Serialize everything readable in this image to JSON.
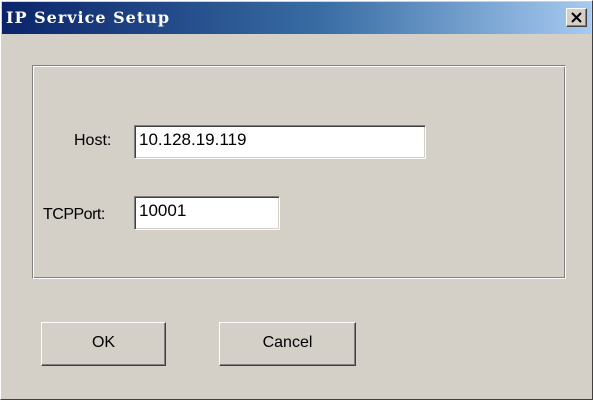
{
  "window": {
    "title": "IP Service Setup",
    "close_icon": "close-x-icon"
  },
  "form": {
    "host_label": "Host:",
    "host_value": "10.128.19.119",
    "port_label": "TCPPort:",
    "port_value": "10001"
  },
  "buttons": {
    "ok_label": "OK",
    "cancel_label": "Cancel"
  },
  "colors": {
    "title_gradient_start": "#0a246a",
    "title_gradient_end": "#a6caf0",
    "face": "#d4d0c8"
  }
}
